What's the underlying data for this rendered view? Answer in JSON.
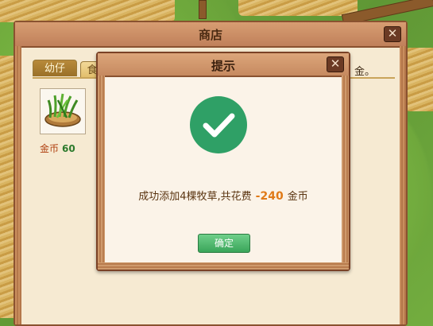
{
  "shop": {
    "title": "商店",
    "close_icon": "close-icon",
    "tabs": [
      {
        "label": "幼仔",
        "active": true
      },
      {
        "label": "食"
      }
    ],
    "hint_tail": "金。",
    "item": {
      "icon": "grass-basket-icon",
      "price_label": "金币",
      "price_value": "60"
    }
  },
  "dialog": {
    "title": "提示",
    "close_icon": "close-icon",
    "status_icon": "check-circle-icon",
    "message_prefix": "成功添加4棵牧草,共花费",
    "cost": "-240",
    "currency": "金币",
    "ok_label": "确定"
  },
  "colors": {
    "frame_brown": "#8a5230",
    "panel_cream": "#fbf3e8",
    "success_green": "#2fa066",
    "cost_orange": "#e07a18",
    "price_green": "#2c7a2c",
    "ok_button_green": "#3aa55a"
  }
}
